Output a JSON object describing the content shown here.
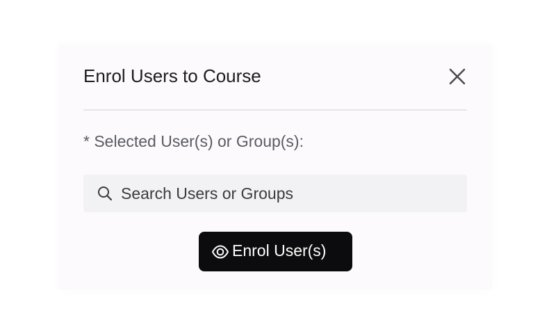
{
  "modal": {
    "title": "Enrol Users to Course",
    "close_icon": "close-icon"
  },
  "form": {
    "selected_label": "* Selected User(s) or Group(s):",
    "search": {
      "icon": "search-icon",
      "placeholder": "Search Users or Groups",
      "value": ""
    },
    "enrol_button": {
      "icon": "eye-icon",
      "label": "Enrol User(s)"
    }
  },
  "colors": {
    "button_bg": "#0c0b0d",
    "button_text": "#ffffff",
    "modal_bg": "#fcfafd",
    "search_bg": "#f2f1f3"
  }
}
